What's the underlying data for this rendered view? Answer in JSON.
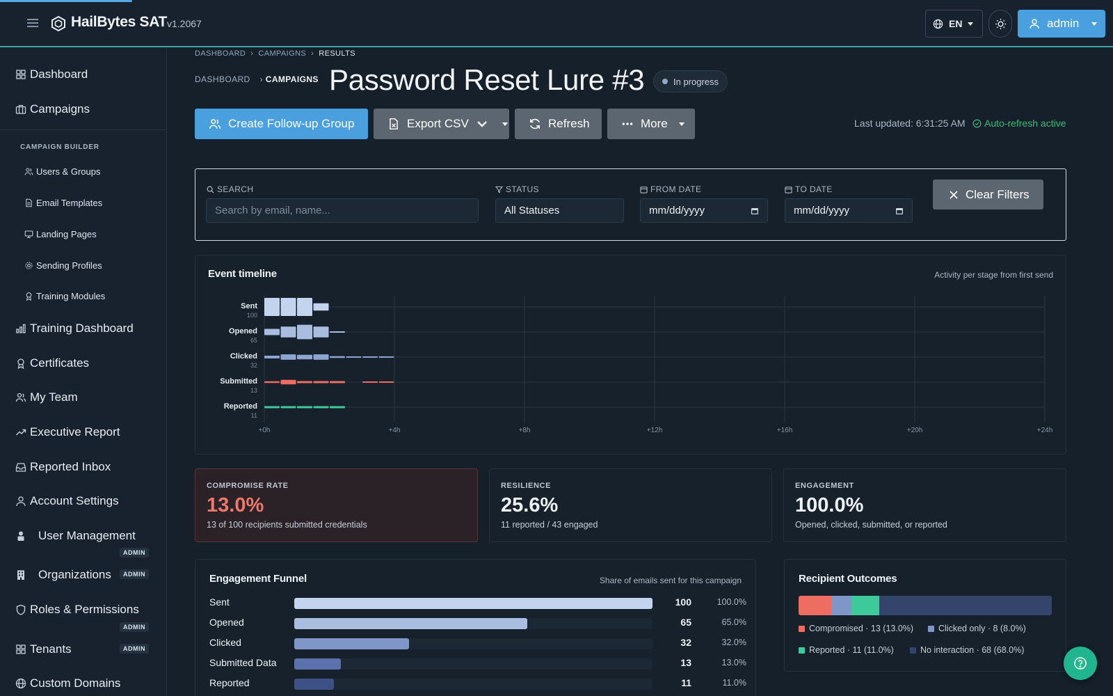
{
  "app": {
    "name": "HailBytes SAT",
    "version": "v1.2067"
  },
  "topbar": {
    "language": "EN",
    "user_label": "admin"
  },
  "sidebar": {
    "items": [
      {
        "label": "Dashboard",
        "icon": "grid-icon"
      },
      {
        "label": "Campaigns",
        "icon": "briefcase-icon"
      },
      {
        "label": "Training Dashboard",
        "icon": "bar-chart-icon"
      },
      {
        "label": "Certificates",
        "icon": "award-icon"
      },
      {
        "label": "My Team",
        "icon": "users-icon"
      },
      {
        "label": "Executive Report",
        "icon": "trending-up-icon"
      },
      {
        "label": "Reported Inbox",
        "icon": "inbox-icon"
      },
      {
        "label": "Account Settings",
        "icon": "user-icon"
      },
      {
        "label": "User Management",
        "icon": "user-lock-icon",
        "badge": "ADMIN"
      },
      {
        "label": "Organizations",
        "icon": "building-icon",
        "badge": "ADMIN"
      },
      {
        "label": "Roles & Permissions",
        "icon": "shield-icon",
        "badge": "ADMIN"
      },
      {
        "label": "Tenants",
        "icon": "grid-icon",
        "badge": "ADMIN"
      },
      {
        "label": "Custom Domains",
        "icon": "globe-icon"
      }
    ],
    "section_label": "CAMPAIGN BUILDER",
    "sub_items": [
      {
        "label": "Users & Groups",
        "icon": "users-icon"
      },
      {
        "label": "Email Templates",
        "icon": "document-icon"
      },
      {
        "label": "Landing Pages",
        "icon": "monitor-icon"
      },
      {
        "label": "Sending Profiles",
        "icon": "gear-icon"
      },
      {
        "label": "Training Modules",
        "icon": "award-icon"
      }
    ]
  },
  "breadcrumb": [
    "DASHBOARD",
    "CAMPAIGNS",
    "RESULTS"
  ],
  "breadcrumb2": [
    "DASHBOARD",
    "CAMPAIGNS"
  ],
  "page": {
    "title": "Password Reset Lure #3",
    "status": "In progress"
  },
  "actions": {
    "follow_up": "Create Follow-up Group",
    "export": "Export CSV",
    "refresh": "Refresh",
    "more": "More",
    "last_updated": "Last updated: 6:31:25 AM",
    "auto_refresh": "Auto-refresh active"
  },
  "filters": {
    "search_label": "SEARCH",
    "search_placeholder": "Search by email, name...",
    "status_label": "STATUS",
    "status_value": "All Statuses",
    "from_label": "FROM DATE",
    "from_value": "mm/dd/yyyy",
    "to_label": "TO DATE",
    "to_value": "mm/dd/yyyy",
    "clear": "Clear Filters"
  },
  "timeline": {
    "title": "Event timeline",
    "subtitle": "Activity per stage from first send",
    "x_ticks": [
      "+0h",
      "+4h",
      "+8h",
      "+12h",
      "+16h",
      "+20h",
      "+24h"
    ],
    "stages": [
      {
        "name": "Sent",
        "count": "100",
        "color": "#c4d4ee",
        "bins": [
          1.0,
          1.0,
          1.0,
          0.4,
          0,
          0,
          0,
          0
        ]
      },
      {
        "name": "Opened",
        "count": "65",
        "color": "#a9bde0",
        "bins": [
          0.35,
          0.6,
          0.8,
          0.6,
          0.08,
          0,
          0,
          0
        ]
      },
      {
        "name": "Clicked",
        "count": "32",
        "color": "#8ea5d2",
        "bins": [
          0.15,
          0.3,
          0.25,
          0.3,
          0.1,
          0.08,
          0.08,
          0.08
        ]
      },
      {
        "name": "Submitted",
        "count": "13",
        "color": "#ee6d62",
        "bins": [
          0.1,
          0.25,
          0.12,
          0.12,
          0.12,
          0,
          0.08,
          0.08
        ]
      },
      {
        "name": "Reported",
        "count": "11",
        "color": "#3ec99b",
        "bins": [
          0.12,
          0.12,
          0.12,
          0.12,
          0.12,
          0,
          0,
          0
        ]
      }
    ]
  },
  "stats": [
    {
      "label": "COMPROMISE RATE",
      "value": "13.0%",
      "desc": "13 of 100 recipients submitted credentials"
    },
    {
      "label": "RESILIENCE",
      "value": "25.6%",
      "desc": "11 reported / 43 engaged"
    },
    {
      "label": "ENGAGEMENT",
      "value": "100.0%",
      "desc": "Opened, clicked, submitted, or reported"
    }
  ],
  "funnel": {
    "title": "Engagement Funnel",
    "subtitle": "Share of emails sent for this campaign",
    "rows": [
      {
        "label": "Sent",
        "count": "100",
        "pct": "100.0%",
        "value": 100,
        "color": "#c4d4ee"
      },
      {
        "label": "Opened",
        "count": "65",
        "pct": "65.0%",
        "value": 65,
        "color": "#a9bde0"
      },
      {
        "label": "Clicked",
        "count": "32",
        "pct": "32.0%",
        "value": 32,
        "color": "#7f97c8"
      },
      {
        "label": "Submitted Data",
        "count": "13",
        "pct": "13.0%",
        "value": 13,
        "color": "#5b71ad"
      },
      {
        "label": "Reported",
        "count": "11",
        "pct": "11.0%",
        "value": 11,
        "color": "#3e5186"
      }
    ]
  },
  "outcomes": {
    "title": "Recipient Outcomes",
    "segments": [
      {
        "label": "Compromised · 13 (13.0%)",
        "value": 13,
        "color": "#ee6d62"
      },
      {
        "label": "Clicked only · 8 (8.0%)",
        "value": 8,
        "color": "#7f97c8"
      },
      {
        "label": "Reported · 11 (11.0%)",
        "value": 11,
        "color": "#3ec99b"
      },
      {
        "label": "No interaction · 68 (68.0%)",
        "value": 68,
        "color": "#34446a"
      }
    ]
  }
}
